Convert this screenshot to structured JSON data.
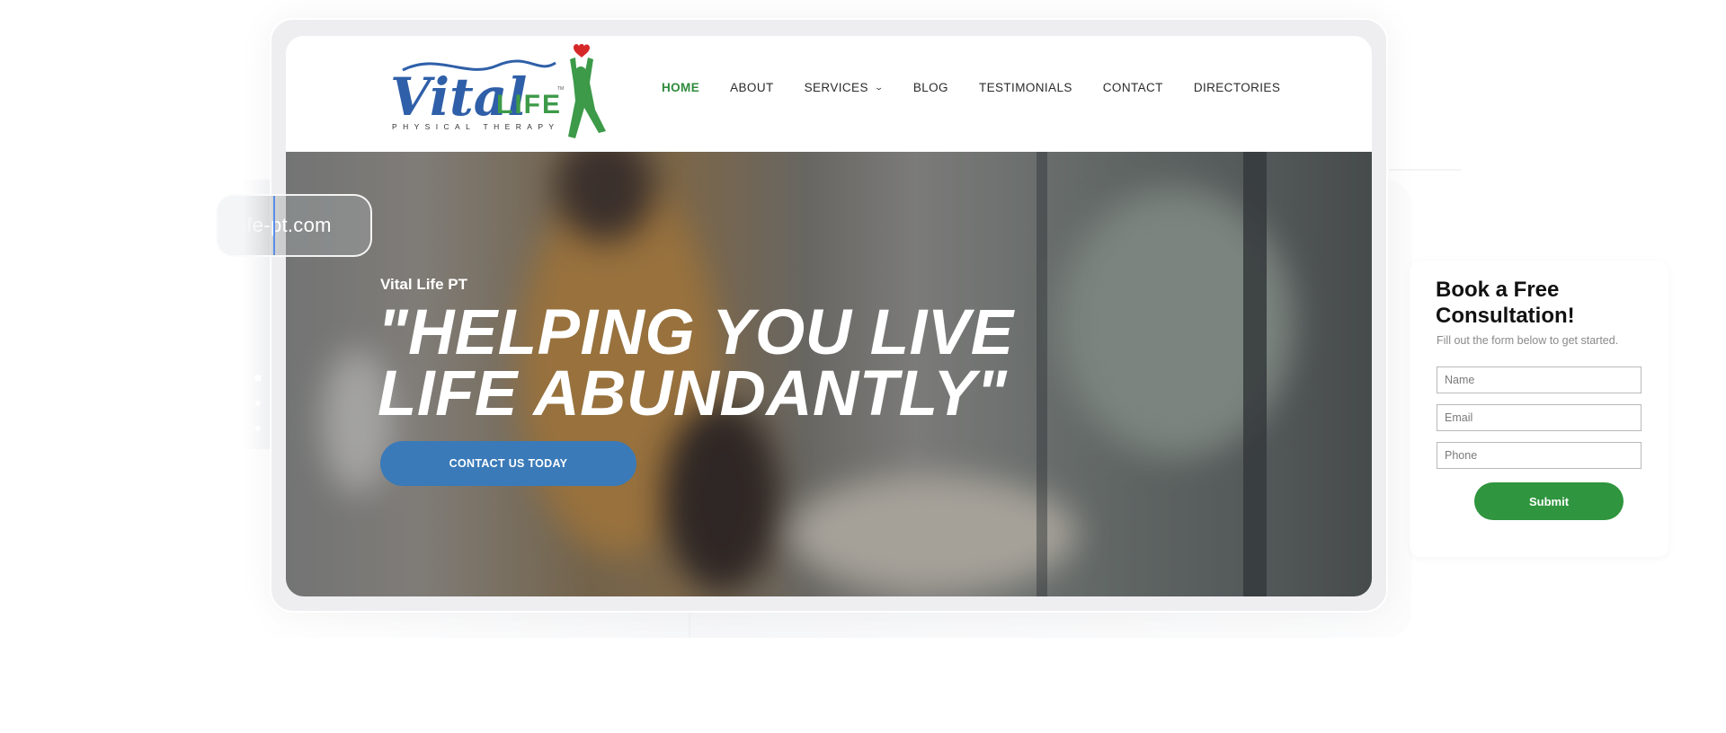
{
  "overlay": {
    "url_fragment": "life-pt.com"
  },
  "brand": {
    "logo_script": "Vital",
    "logo_word": "LIFE",
    "logo_tagline": "PHYSICAL THERAPY",
    "logo_tm": "TM",
    "colors": {
      "blue": "#2f5fa8",
      "green": "#3c9a48",
      "red": "#d62828"
    }
  },
  "nav": {
    "items": [
      {
        "label": "HOME",
        "active": true
      },
      {
        "label": "ABOUT"
      },
      {
        "label": "SERVICES",
        "has_dropdown": true,
        "icon": "chevron-down-icon"
      },
      {
        "label": "BLOG"
      },
      {
        "label": "TESTIMONIALS"
      },
      {
        "label": "CONTACT"
      },
      {
        "label": "DIRECTORIES"
      }
    ],
    "active_color": "#2f8a3b"
  },
  "hero": {
    "subtitle": "Vital Life PT",
    "title_line1": "\"HELPING YOU LIVE",
    "title_line2": "LIFE ABUNDANTLY\"",
    "cta_label": "CONTACT US TODAY",
    "cta_color": "#3a7ab8"
  },
  "consultation": {
    "title": "Book a Free Consultation!",
    "subtitle": "Fill out the form below to get started.",
    "fields": [
      {
        "placeholder": "Name",
        "value": ""
      },
      {
        "placeholder": "Email",
        "value": ""
      },
      {
        "placeholder": "Phone",
        "value": ""
      }
    ],
    "submit_label": "Submit",
    "submit_color": "#2f953e"
  }
}
